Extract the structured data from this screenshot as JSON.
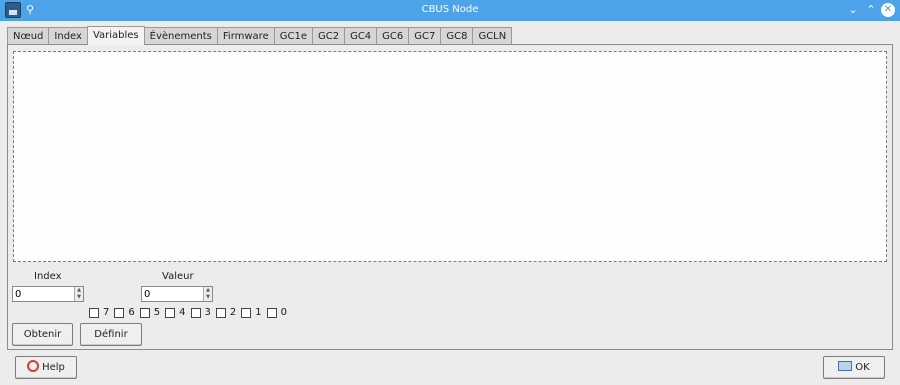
{
  "window": {
    "title": "CBUS Node",
    "minimize_glyph": "⌄",
    "maximize_glyph": "⌃",
    "close_glyph": "✕",
    "pin_glyph": "📌"
  },
  "tabs": [
    {
      "label": "Nœud"
    },
    {
      "label": "Index"
    },
    {
      "label": "Variables"
    },
    {
      "label": "Évènements"
    },
    {
      "label": "Firmware"
    },
    {
      "label": "GC1e"
    },
    {
      "label": "GC2"
    },
    {
      "label": "GC4"
    },
    {
      "label": "GC6"
    },
    {
      "label": "GC7"
    },
    {
      "label": "GC8"
    },
    {
      "label": "GCLN"
    }
  ],
  "active_tab": "Variables",
  "variables": {
    "index_label": "Index",
    "index_value": "0",
    "value_label": "Valeur",
    "value_value": "0",
    "bits": [
      "7",
      "6",
      "5",
      "4",
      "3",
      "2",
      "1",
      "0"
    ],
    "get_button": "Obtenir",
    "set_button": "Définir"
  },
  "footer": {
    "help_button": "Help",
    "ok_button": "OK"
  },
  "colors": {
    "titlebar": "#4da3e8",
    "background": "#ececec"
  }
}
